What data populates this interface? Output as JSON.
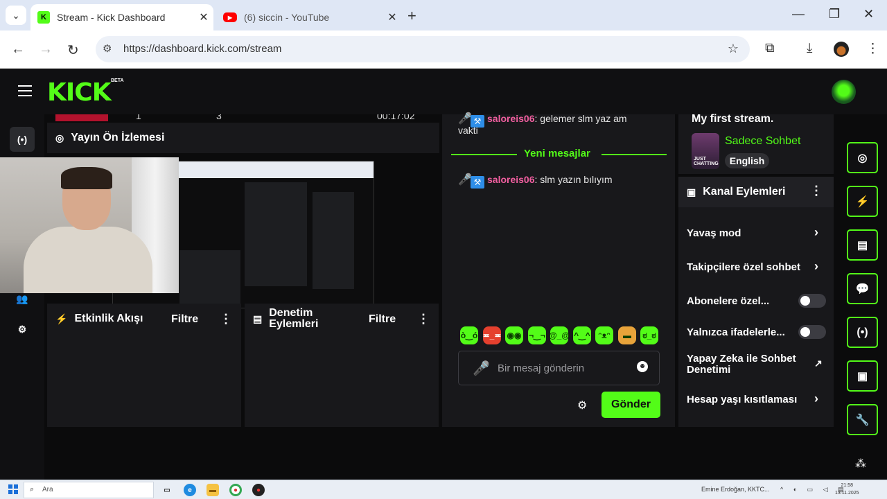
{
  "browser": {
    "tabs": [
      {
        "title": "Stream - Kick Dashboard",
        "favicon": "kick-icon",
        "active": true
      },
      {
        "title": "(6) siccin - YouTube",
        "favicon": "youtube-icon",
        "active": false
      }
    ],
    "url": "https://dashboard.kick.com/stream"
  },
  "header": {
    "logo": "KICK",
    "beta": "BETA"
  },
  "stats_strip": {
    "value1": "1",
    "value2": "3",
    "uptime": "00:17:02"
  },
  "preview_panel": {
    "title": "Yayın Ön İzlemesi"
  },
  "activity_panel": {
    "title": "Etkinlik Akışı",
    "filter": "Filtre"
  },
  "moderation_panel": {
    "title": "Denetim Eylemleri",
    "filter": "Filtre"
  },
  "chat": {
    "top_username": "saloreis06",
    "top_message": ": gelemer slm yaz am",
    "top_message_cont": "vakti",
    "new_messages_label": "Yeni mesajlar",
    "messages": [
      {
        "username": "saloreis06",
        "text": ": slm yazın bılıyım"
      }
    ],
    "emotes": [
      "angel",
      "angry",
      "clown",
      "smirk",
      "dizzy",
      "grin",
      "happy",
      "burger",
      "grimace"
    ],
    "input_placeholder": "Bir mesaj gönderin",
    "send_label": "Gönder"
  },
  "stream_info": {
    "title": "My first stream.",
    "category": "Sadece Sohbet",
    "category_thumb": "JUST CHATTING",
    "language": "English"
  },
  "channel_actions": {
    "title": "Kanal Eylemleri",
    "items": [
      {
        "label": "Yavaş mod",
        "kind": "link"
      },
      {
        "label": "Takipçilere özel sohbet",
        "kind": "link"
      },
      {
        "label": "Abonelere özel...",
        "kind": "toggle",
        "on": false
      },
      {
        "label": "Yalnızca ifadelerle...",
        "kind": "toggle",
        "on": false
      },
      {
        "label": "Yapay Zeka ile Sohbet Denetimi",
        "kind": "external"
      },
      {
        "label": "Hesap yaşı kısıtlaması",
        "kind": "link"
      }
    ]
  },
  "taskbar": {
    "search_placeholder": "Ara",
    "news": "Emine Erdoğan, KKTC...",
    "time": "21:58",
    "date": "13.11.2025"
  },
  "colors": {
    "accent": "#53fc18",
    "username": "#f15fa0",
    "background": "#0b0b0c",
    "panel": "#18181b"
  }
}
